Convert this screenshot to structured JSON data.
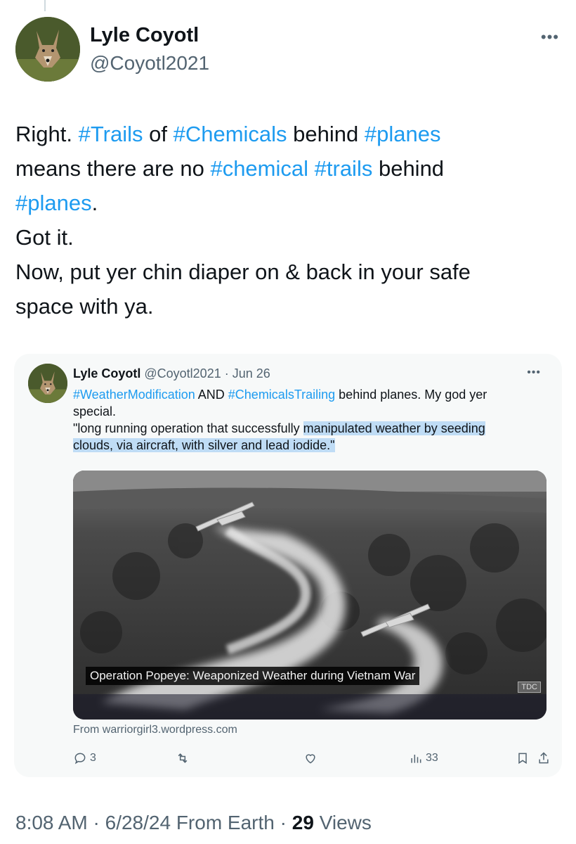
{
  "tweet": {
    "author_name": "Lyle Coyotl",
    "author_handle": "@Coyotl2021",
    "more_icon": "more-horizontal-icon",
    "text_lines": [
      [
        {
          "t": "Right. ",
          "h": false
        },
        {
          "t": "#Trails",
          "h": true
        },
        {
          "t": " of ",
          "h": false
        },
        {
          "t": "#Chemicals",
          "h": true
        },
        {
          "t": " behind ",
          "h": false
        },
        {
          "t": "#planes",
          "h": true
        }
      ],
      [
        {
          "t": "means there are no ",
          "h": false
        },
        {
          "t": "#chemical",
          "h": true
        },
        {
          "t": " ",
          "h": false
        },
        {
          "t": "#trails",
          "h": true
        },
        {
          "t": " behind",
          "h": false
        }
      ],
      [
        {
          "t": "#planes",
          "h": true
        },
        {
          "t": ".",
          "h": false
        }
      ],
      [
        {
          "t": "Got it.",
          "h": false
        }
      ],
      [
        {
          "t": "Now, put yer chin diaper on & back in your safe",
          "h": false
        }
      ],
      [
        {
          "t": "space with ya.",
          "h": false
        }
      ]
    ],
    "time": "8:08 AM",
    "date": "6/28/24",
    "source": "From Earth",
    "views_count": "29",
    "views_label": "Views"
  },
  "quoted": {
    "author_name": "Lyle Coyotl",
    "author_handle": "@Coyotl2021",
    "date": "Jun 26",
    "text_lines": [
      [
        {
          "t": "#WeatherModification",
          "h": true,
          "m": false
        },
        {
          "t": " AND ",
          "h": false,
          "m": false
        },
        {
          "t": "#ChemicalsTrailing",
          "h": true,
          "m": false
        },
        {
          "t": " behind planes. My god yer",
          "h": false,
          "m": false
        }
      ],
      [
        {
          "t": "special.",
          "h": false,
          "m": false
        }
      ],
      [
        {
          "t": "\"long running operation that successfully ",
          "h": false,
          "m": false
        },
        {
          "t": "manipulated weather by seeding",
          "h": false,
          "m": true
        }
      ],
      [
        {
          "t": "clouds, via aircraft, with silver and lead iodide.\"",
          "h": false,
          "m": true
        }
      ]
    ],
    "media_caption": "Operation Popeye: Weaponized Weather during Vietnam War",
    "media_watermark": "TDC",
    "link_source": "From warriorgirl3.wordpress.com",
    "actions": {
      "reply_count": "3",
      "retweet_count": "",
      "like_count": "",
      "views_count": "33"
    }
  },
  "colors": {
    "link": "#1d9bf0",
    "secondary_text": "#536471",
    "highlight": "#bfdcf5",
    "card_bg": "#f7f9f9"
  }
}
